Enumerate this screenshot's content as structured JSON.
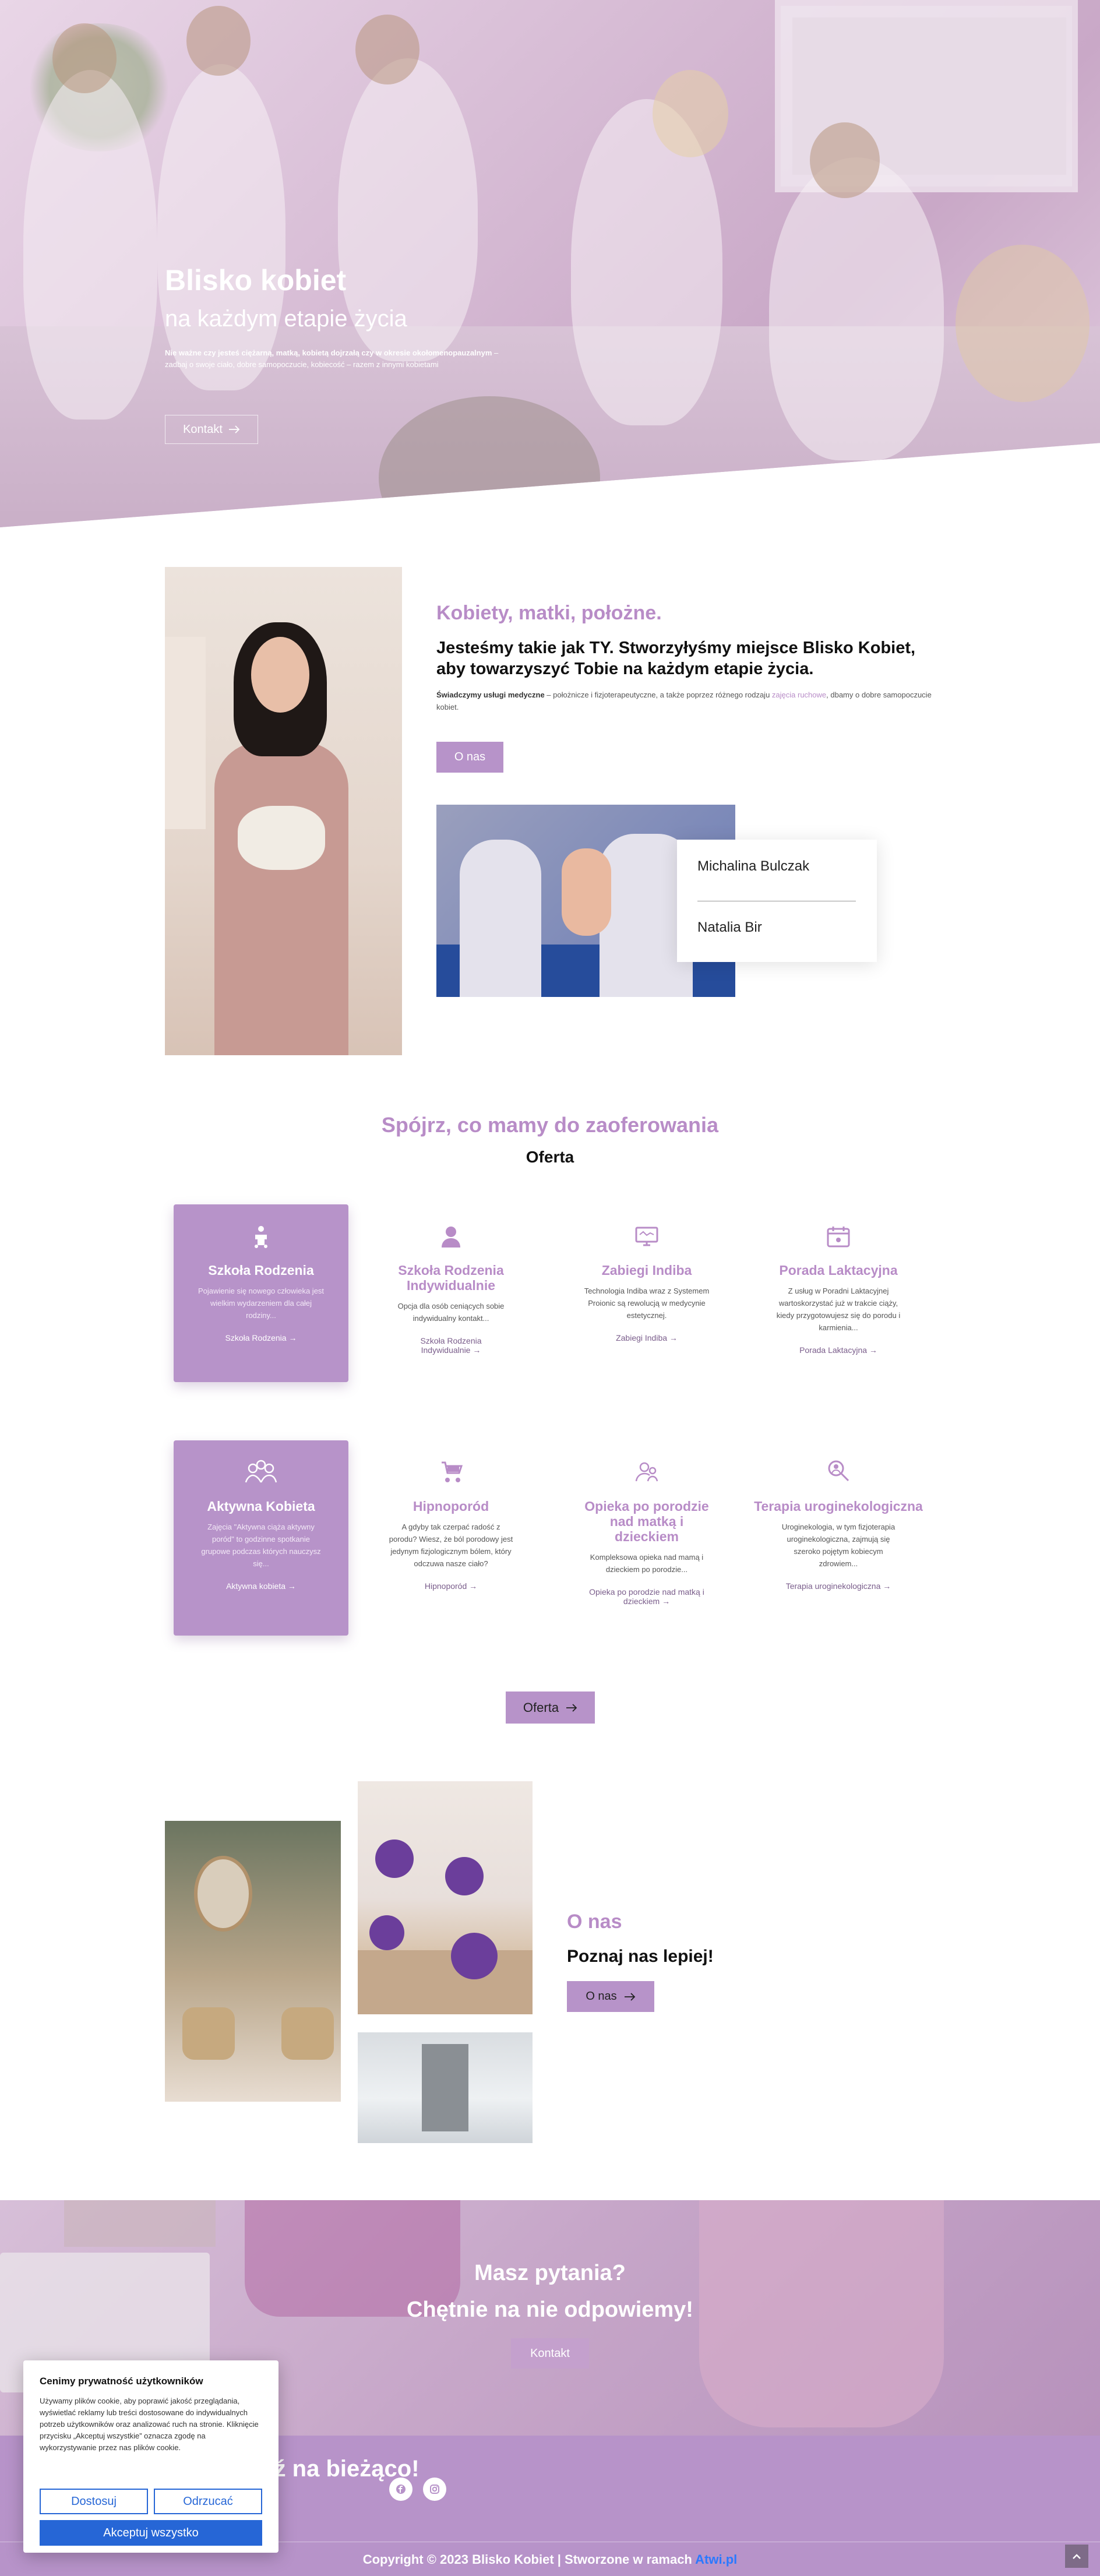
{
  "hero": {
    "title": "Blisko kobiet",
    "subtitle": "na każdym etapie życia",
    "desc_bold": "Nie ważne czy jesteś ciężarną, matką, kobietą dojrzałą czy w okresie okołomenopauzalnym",
    "desc_rest": " – zadbaj o swoje ciało, dobre samopoczucie, kobiecość – razem z innymi kobietami",
    "button": "Kontakt"
  },
  "about": {
    "heading": "Kobiety, matki, położne.",
    "subheading": "Jesteśmy takie jak TY. Stworzyłyśmy miejsce Blisko Kobiet, aby towarzyszyć Tobie na każdym etapie życia.",
    "p_bold": "Świadczymy usługi medyczne",
    "p_mid": " – położnicze i fizjoterapeutyczne, a także poprzez różnego rodzaju ",
    "p_link": "zajęcia ruchowe",
    "p_end": ", dbamy o dobre samopoczucie kobiet.",
    "button": "O nas",
    "team": [
      "Michalina Bulczak",
      "Natalia Bir"
    ]
  },
  "offer": {
    "heading": "Spójrz, co mamy do zaoferowania",
    "subheading": "Oferta",
    "button": "Oferta",
    "cards": [
      {
        "title": "Szkoła Rodzenia",
        "desc": "Pojawienie się nowego człowieka jest wielkim wydarzeniem dla całej rodziny...",
        "link": "Szkoła Rodzenia",
        "icon": "baby-icon"
      },
      {
        "title": "Szkoła Rodzenia Indywidualnie",
        "desc": "Opcja dla osób ceniących sobie indywidualny kontakt...",
        "link": "Szkoła Rodzenia Indywidualnie",
        "icon": "person-icon"
      },
      {
        "title": "Zabiegi Indiba",
        "desc": "Technologia Indiba wraz z Systemem Proionic są rewolucją w medycynie estetycznej.",
        "link": "Zabiegi Indiba",
        "icon": "device-icon"
      },
      {
        "title": "Porada Laktacyjna",
        "desc": "Z usług w Poradni Laktacyjnej wartoskorzystać już w trakcie ciąży, kiedy przygotowujesz się do porodu i karmienia...",
        "link": "Porada Laktacyjna",
        "icon": "calendar-icon"
      },
      {
        "title": "Aktywna Kobieta",
        "desc": "Zajęcia \"Aktywna ciąża aktywny poród\" to godzinne spotkanie grupowe podczas których nauczysz się...",
        "link": "Aktywna kobieta",
        "icon": "group-icon"
      },
      {
        "title": "Hipnoporód",
        "desc": "A gdyby tak czerpać radość z porodu? Wiesz, że ból porodowy jest jedynym fizjologicznym bólem, który odczuwa nasze ciało?",
        "link": "Hipnoporód",
        "icon": "stroller-icon"
      },
      {
        "title": "Opieka po porodzie nad matką i dzieckiem",
        "desc": "Kompleksowa opieka nad mamą i dzieckiem po porodzie...",
        "link": "Opieka po porodzie nad matką i dzieckiem",
        "icon": "parent-icon"
      },
      {
        "title": "Terapia uroginekologiczna",
        "desc": "Uroginekologia, w tym fizjoterapia uroginekologiczna, zajmują się szeroko pojętym kobiecym zdrowiem...",
        "link": "Terapia uroginekologiczna",
        "icon": "search-person-icon"
      }
    ]
  },
  "about2": {
    "heading": "O nas",
    "subheading": "Poznaj nas lepiej!",
    "button": "O nas"
  },
  "cta": {
    "line1": "Masz pytania?",
    "line2": "Chętnie na nie odpowiemy!",
    "button": "Kontakt"
  },
  "footer": {
    "follow": "Bądź na bieżąco!",
    "copyright_pre": "Copyright © 2023 Blisko Kobiet | Stworzone w ramach ",
    "copyright_brand": "Atwi.pl",
    "social": [
      "facebook-icon",
      "instagram-icon"
    ]
  },
  "cookie": {
    "title": "Cenimy prywatność użytkowników",
    "text": "Używamy plików cookie, aby poprawić jakość przeglądania, wyświetlać reklamy lub treści dostosowane do indywidualnych potrzeb użytkowników oraz analizować ruch na stronie. Kliknięcie przycisku „Akceptuj wszystkie” oznacza zgodę na wykorzystywanie przez nas plików cookie.",
    "customize": "Dostosuj",
    "reject": "Odrzucać",
    "accept": "Akceptuj wszystko"
  },
  "colors": {
    "accent": "#b793c9",
    "heading": "#b88cc7",
    "cookie_blue": "#2666d6"
  }
}
